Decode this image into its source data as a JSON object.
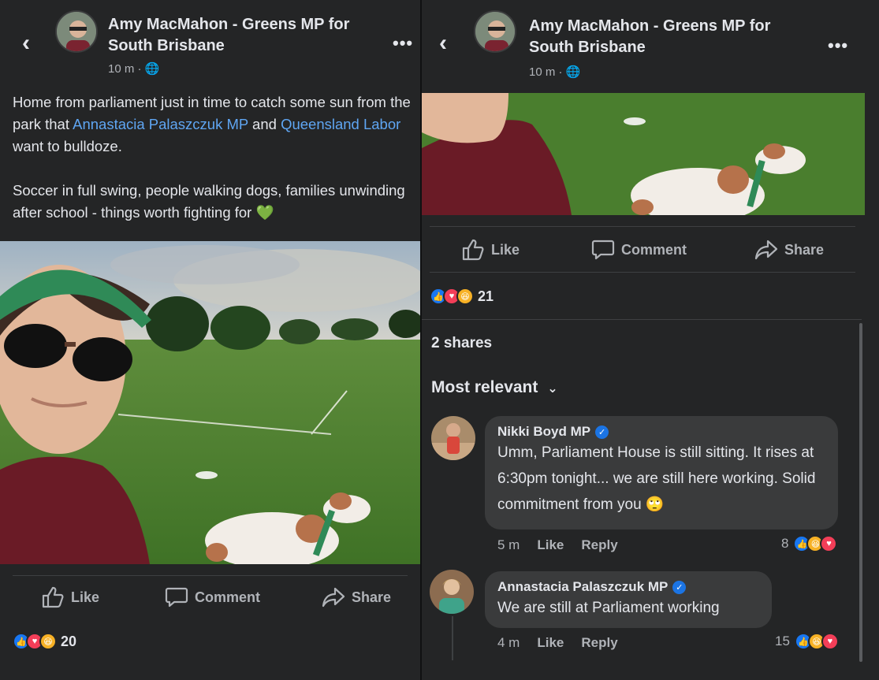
{
  "left": {
    "author": "Amy MacMahon - Greens MP for South Brisbane",
    "time": "10 m",
    "post": {
      "line1_before": "Home from parliament just in time to catch some sun from the park that ",
      "tag1": "Annastacia Palaszczuk MP",
      "line1_mid": " and ",
      "tag2": "Queensland Labor",
      "line1_after": " want to bulldoze.",
      "paragraph2": "Soccer in full swing, people walking dogs, families unwinding after school - things worth fighting for",
      "emoji": "💚"
    },
    "actions": {
      "like": "Like",
      "comment": "Comment",
      "share": "Share"
    },
    "reaction_count": "20"
  },
  "right": {
    "author": "Amy MacMahon - Greens MP for South Brisbane",
    "time": "10 m",
    "actions": {
      "like": "Like",
      "comment": "Comment",
      "share": "Share"
    },
    "reaction_count": "21",
    "shares": "2 shares",
    "sort_label": "Most relevant",
    "comments": [
      {
        "name": "Nikki Boyd MP",
        "text": "Umm, Parliament House is still sitting. It rises at 6:30pm tonight... we are still here working. Solid commitment from you 🙄",
        "time": "5 m",
        "like": "Like",
        "reply": "Reply",
        "count": "8"
      },
      {
        "name": "Annastacia Palaszczuk MP",
        "text": "We are still at Parliament working",
        "time": "4 m",
        "like": "Like",
        "reply": "Reply",
        "count": "15"
      }
    ]
  },
  "colors": {
    "background": "#242526",
    "link": "#5fa6f3",
    "like_blue": "#1877f2",
    "love_red": "#f33e58",
    "haha_yellow": "#f7b125",
    "bubble": "#3a3b3c"
  },
  "icons": [
    "back-arrow-icon",
    "globe-icon",
    "more-icon",
    "thumbs-up-icon",
    "comment-bubble-icon",
    "share-arrow-icon",
    "verified-badge-icon",
    "chevron-down-icon"
  ]
}
